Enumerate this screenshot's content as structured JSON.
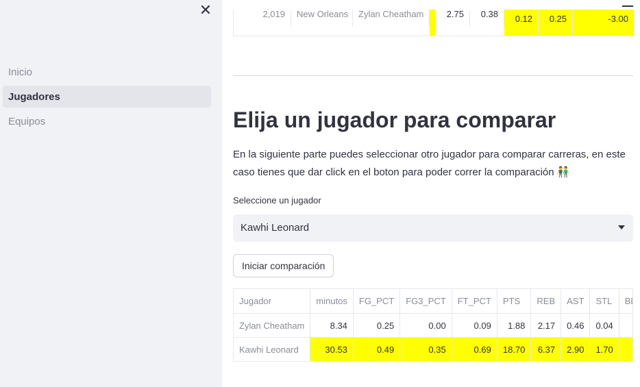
{
  "sidebar": {
    "items": [
      {
        "label": "Inicio",
        "active": false
      },
      {
        "label": "Jugadores",
        "active": true
      },
      {
        "label": "Equipos",
        "active": false
      }
    ]
  },
  "top_table_row": {
    "col1": "2,019",
    "col2": "New Orleans",
    "col3": "Zylan Cheatham",
    "col4": "2.75",
    "col5": "0.38",
    "col6": "0.12",
    "col7": "0.25",
    "col8": "-3.00"
  },
  "main": {
    "title": "Elija un jugador para comparar",
    "description": "En la siguiente parte puedes seleccionar otro jugador para comparar carreras, en este caso tienes que dar click en el boton para poder correr la comparación 👬",
    "select_label": "Seleccione un jugador",
    "select_value": "Kawhi Leonard",
    "button_label": "Iniciar comparación"
  },
  "comparison_table": {
    "headers": [
      "Jugador",
      "minutos",
      "FG_PCT",
      "FG3_PCT",
      "FT_PCT",
      "PTS",
      "REB",
      "AST",
      "STL",
      "BLK"
    ],
    "rows": [
      [
        "Zylan Cheatham",
        "8.34",
        "0.25",
        "0.00",
        "0.09",
        "1.88",
        "2.17",
        "0.46",
        "0.04",
        ""
      ],
      [
        "Kawhi Leonard",
        "30.53",
        "0.49",
        "0.35",
        "0.69",
        "18.70",
        "6.37",
        "2.90",
        "1.70",
        ""
      ]
    ]
  },
  "colors": {
    "highlight": "#ffff00",
    "sidebar_bg": "#f0f2f6",
    "text": "#31333f"
  }
}
